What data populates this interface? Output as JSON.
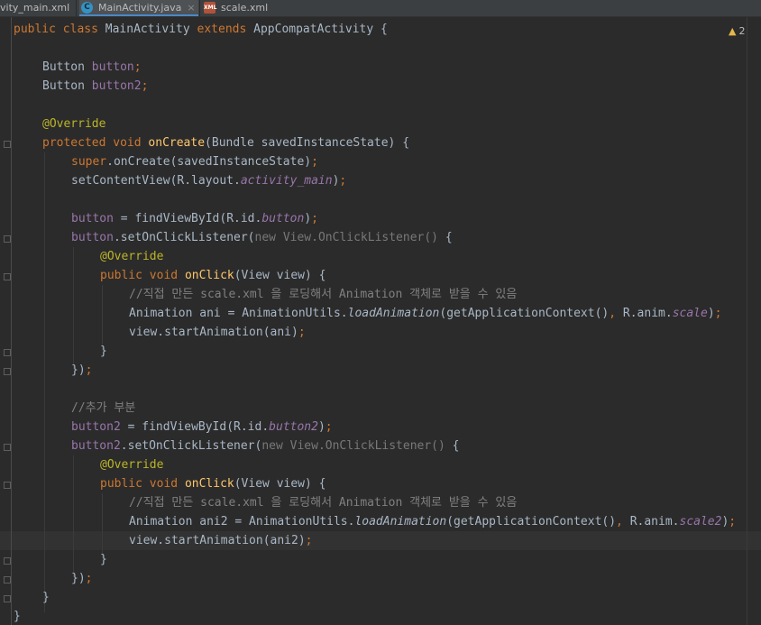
{
  "tabs": [
    {
      "label": "vity_main.xml",
      "active": false,
      "icon": "xml-file-icon"
    },
    {
      "label": "MainActivity.java",
      "active": true,
      "icon": "java-class-icon",
      "icon_text": "C"
    },
    {
      "label": "scale.xml",
      "active": false,
      "icon": "xml-file-icon",
      "icon_text": "XML"
    }
  ],
  "close_symbol": "×",
  "inspections": {
    "warning_count": "2",
    "icon": "warning-icon"
  },
  "colors": {
    "background": "#2b2b2b",
    "keyword": "#cc7832",
    "method": "#ffc66d",
    "annotation": "#bbb529",
    "field": "#9876aa",
    "comment": "#808080",
    "text": "#a9b7c6"
  },
  "code": {
    "class_decl": [
      "public",
      "class",
      "MainActivity",
      "extends",
      "AppCompatActivity",
      "{"
    ],
    "field1": [
      "Button",
      "button",
      ";"
    ],
    "field2": [
      "Button",
      "button2",
      ";"
    ],
    "override": "@Override",
    "oncreate": [
      "protected",
      "void",
      "onCreate",
      "(Bundle savedInstanceState) {"
    ],
    "super_call": [
      "super",
      ".onCreate(savedInstanceState)",
      ";"
    ],
    "setcontent": [
      "setContentView(R.layout.",
      "activity_main",
      ")",
      ";"
    ],
    "find1": [
      "button",
      " = findViewById(R.id.",
      "button",
      ")",
      ";"
    ],
    "listener1": [
      "button",
      ".setOnClickListener(",
      "new View.OnClickListener()",
      " {"
    ],
    "onclick": [
      "public",
      "void",
      "onClick",
      "(View view) {"
    ],
    "comment_korean": "//직접 만든 scale.xml 을 로딩해서 Animation 객체로 받을 수 있음",
    "ani1": [
      "Animation ani = AnimationUtils.",
      "loadAnimation",
      "(getApplicationContext()",
      ",",
      " R.anim.",
      "scale",
      ")",
      ";"
    ],
    "start1": [
      "view.startAnimation(ani)",
      ";"
    ],
    "close_brace": "}",
    "close_listener": [
      "})",
      ";"
    ],
    "comment_added": "//추가 부분",
    "find2": [
      "button2",
      " = findViewById(R.id.",
      "button2",
      ")",
      ";"
    ],
    "listener2": [
      "button2",
      ".setOnClickListener(",
      "new View.OnClickListener()",
      " {"
    ],
    "ani2": [
      "Animation ani2 = AnimationUtils.",
      "loadAnimation",
      "(getApplicationContext()",
      ",",
      " R.anim.",
      "scale2",
      ")",
      ";"
    ],
    "start2": [
      "view.startAnimation(ani2)",
      ";"
    ]
  }
}
